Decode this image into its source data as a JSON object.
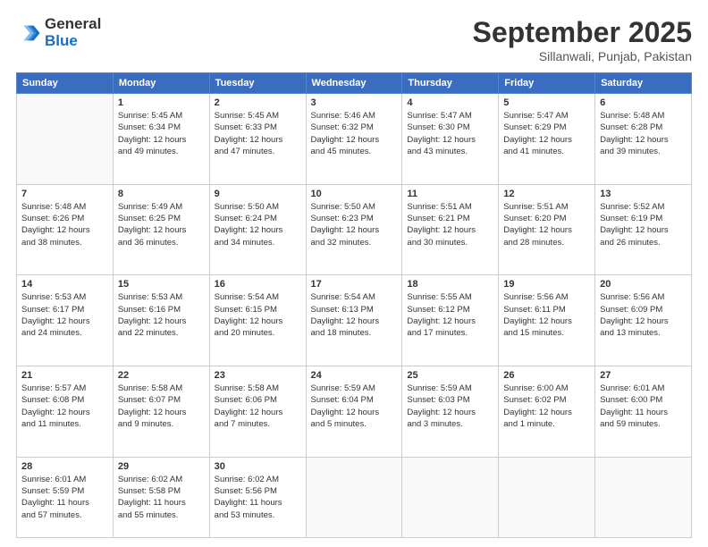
{
  "header": {
    "logo_general": "General",
    "logo_blue": "Blue",
    "month_title": "September 2025",
    "subtitle": "Sillanwali, Punjab, Pakistan"
  },
  "weekdays": [
    "Sunday",
    "Monday",
    "Tuesday",
    "Wednesday",
    "Thursday",
    "Friday",
    "Saturday"
  ],
  "weeks": [
    [
      {
        "day": "",
        "info": ""
      },
      {
        "day": "1",
        "info": "Sunrise: 5:45 AM\nSunset: 6:34 PM\nDaylight: 12 hours\nand 49 minutes."
      },
      {
        "day": "2",
        "info": "Sunrise: 5:45 AM\nSunset: 6:33 PM\nDaylight: 12 hours\nand 47 minutes."
      },
      {
        "day": "3",
        "info": "Sunrise: 5:46 AM\nSunset: 6:32 PM\nDaylight: 12 hours\nand 45 minutes."
      },
      {
        "day": "4",
        "info": "Sunrise: 5:47 AM\nSunset: 6:30 PM\nDaylight: 12 hours\nand 43 minutes."
      },
      {
        "day": "5",
        "info": "Sunrise: 5:47 AM\nSunset: 6:29 PM\nDaylight: 12 hours\nand 41 minutes."
      },
      {
        "day": "6",
        "info": "Sunrise: 5:48 AM\nSunset: 6:28 PM\nDaylight: 12 hours\nand 39 minutes."
      }
    ],
    [
      {
        "day": "7",
        "info": "Sunrise: 5:48 AM\nSunset: 6:26 PM\nDaylight: 12 hours\nand 38 minutes."
      },
      {
        "day": "8",
        "info": "Sunrise: 5:49 AM\nSunset: 6:25 PM\nDaylight: 12 hours\nand 36 minutes."
      },
      {
        "day": "9",
        "info": "Sunrise: 5:50 AM\nSunset: 6:24 PM\nDaylight: 12 hours\nand 34 minutes."
      },
      {
        "day": "10",
        "info": "Sunrise: 5:50 AM\nSunset: 6:23 PM\nDaylight: 12 hours\nand 32 minutes."
      },
      {
        "day": "11",
        "info": "Sunrise: 5:51 AM\nSunset: 6:21 PM\nDaylight: 12 hours\nand 30 minutes."
      },
      {
        "day": "12",
        "info": "Sunrise: 5:51 AM\nSunset: 6:20 PM\nDaylight: 12 hours\nand 28 minutes."
      },
      {
        "day": "13",
        "info": "Sunrise: 5:52 AM\nSunset: 6:19 PM\nDaylight: 12 hours\nand 26 minutes."
      }
    ],
    [
      {
        "day": "14",
        "info": "Sunrise: 5:53 AM\nSunset: 6:17 PM\nDaylight: 12 hours\nand 24 minutes."
      },
      {
        "day": "15",
        "info": "Sunrise: 5:53 AM\nSunset: 6:16 PM\nDaylight: 12 hours\nand 22 minutes."
      },
      {
        "day": "16",
        "info": "Sunrise: 5:54 AM\nSunset: 6:15 PM\nDaylight: 12 hours\nand 20 minutes."
      },
      {
        "day": "17",
        "info": "Sunrise: 5:54 AM\nSunset: 6:13 PM\nDaylight: 12 hours\nand 18 minutes."
      },
      {
        "day": "18",
        "info": "Sunrise: 5:55 AM\nSunset: 6:12 PM\nDaylight: 12 hours\nand 17 minutes."
      },
      {
        "day": "19",
        "info": "Sunrise: 5:56 AM\nSunset: 6:11 PM\nDaylight: 12 hours\nand 15 minutes."
      },
      {
        "day": "20",
        "info": "Sunrise: 5:56 AM\nSunset: 6:09 PM\nDaylight: 12 hours\nand 13 minutes."
      }
    ],
    [
      {
        "day": "21",
        "info": "Sunrise: 5:57 AM\nSunset: 6:08 PM\nDaylight: 12 hours\nand 11 minutes."
      },
      {
        "day": "22",
        "info": "Sunrise: 5:58 AM\nSunset: 6:07 PM\nDaylight: 12 hours\nand 9 minutes."
      },
      {
        "day": "23",
        "info": "Sunrise: 5:58 AM\nSunset: 6:06 PM\nDaylight: 12 hours\nand 7 minutes."
      },
      {
        "day": "24",
        "info": "Sunrise: 5:59 AM\nSunset: 6:04 PM\nDaylight: 12 hours\nand 5 minutes."
      },
      {
        "day": "25",
        "info": "Sunrise: 5:59 AM\nSunset: 6:03 PM\nDaylight: 12 hours\nand 3 minutes."
      },
      {
        "day": "26",
        "info": "Sunrise: 6:00 AM\nSunset: 6:02 PM\nDaylight: 12 hours\nand 1 minute."
      },
      {
        "day": "27",
        "info": "Sunrise: 6:01 AM\nSunset: 6:00 PM\nDaylight: 11 hours\nand 59 minutes."
      }
    ],
    [
      {
        "day": "28",
        "info": "Sunrise: 6:01 AM\nSunset: 5:59 PM\nDaylight: 11 hours\nand 57 minutes."
      },
      {
        "day": "29",
        "info": "Sunrise: 6:02 AM\nSunset: 5:58 PM\nDaylight: 11 hours\nand 55 minutes."
      },
      {
        "day": "30",
        "info": "Sunrise: 6:02 AM\nSunset: 5:56 PM\nDaylight: 11 hours\nand 53 minutes."
      },
      {
        "day": "",
        "info": ""
      },
      {
        "day": "",
        "info": ""
      },
      {
        "day": "",
        "info": ""
      },
      {
        "day": "",
        "info": ""
      }
    ]
  ]
}
